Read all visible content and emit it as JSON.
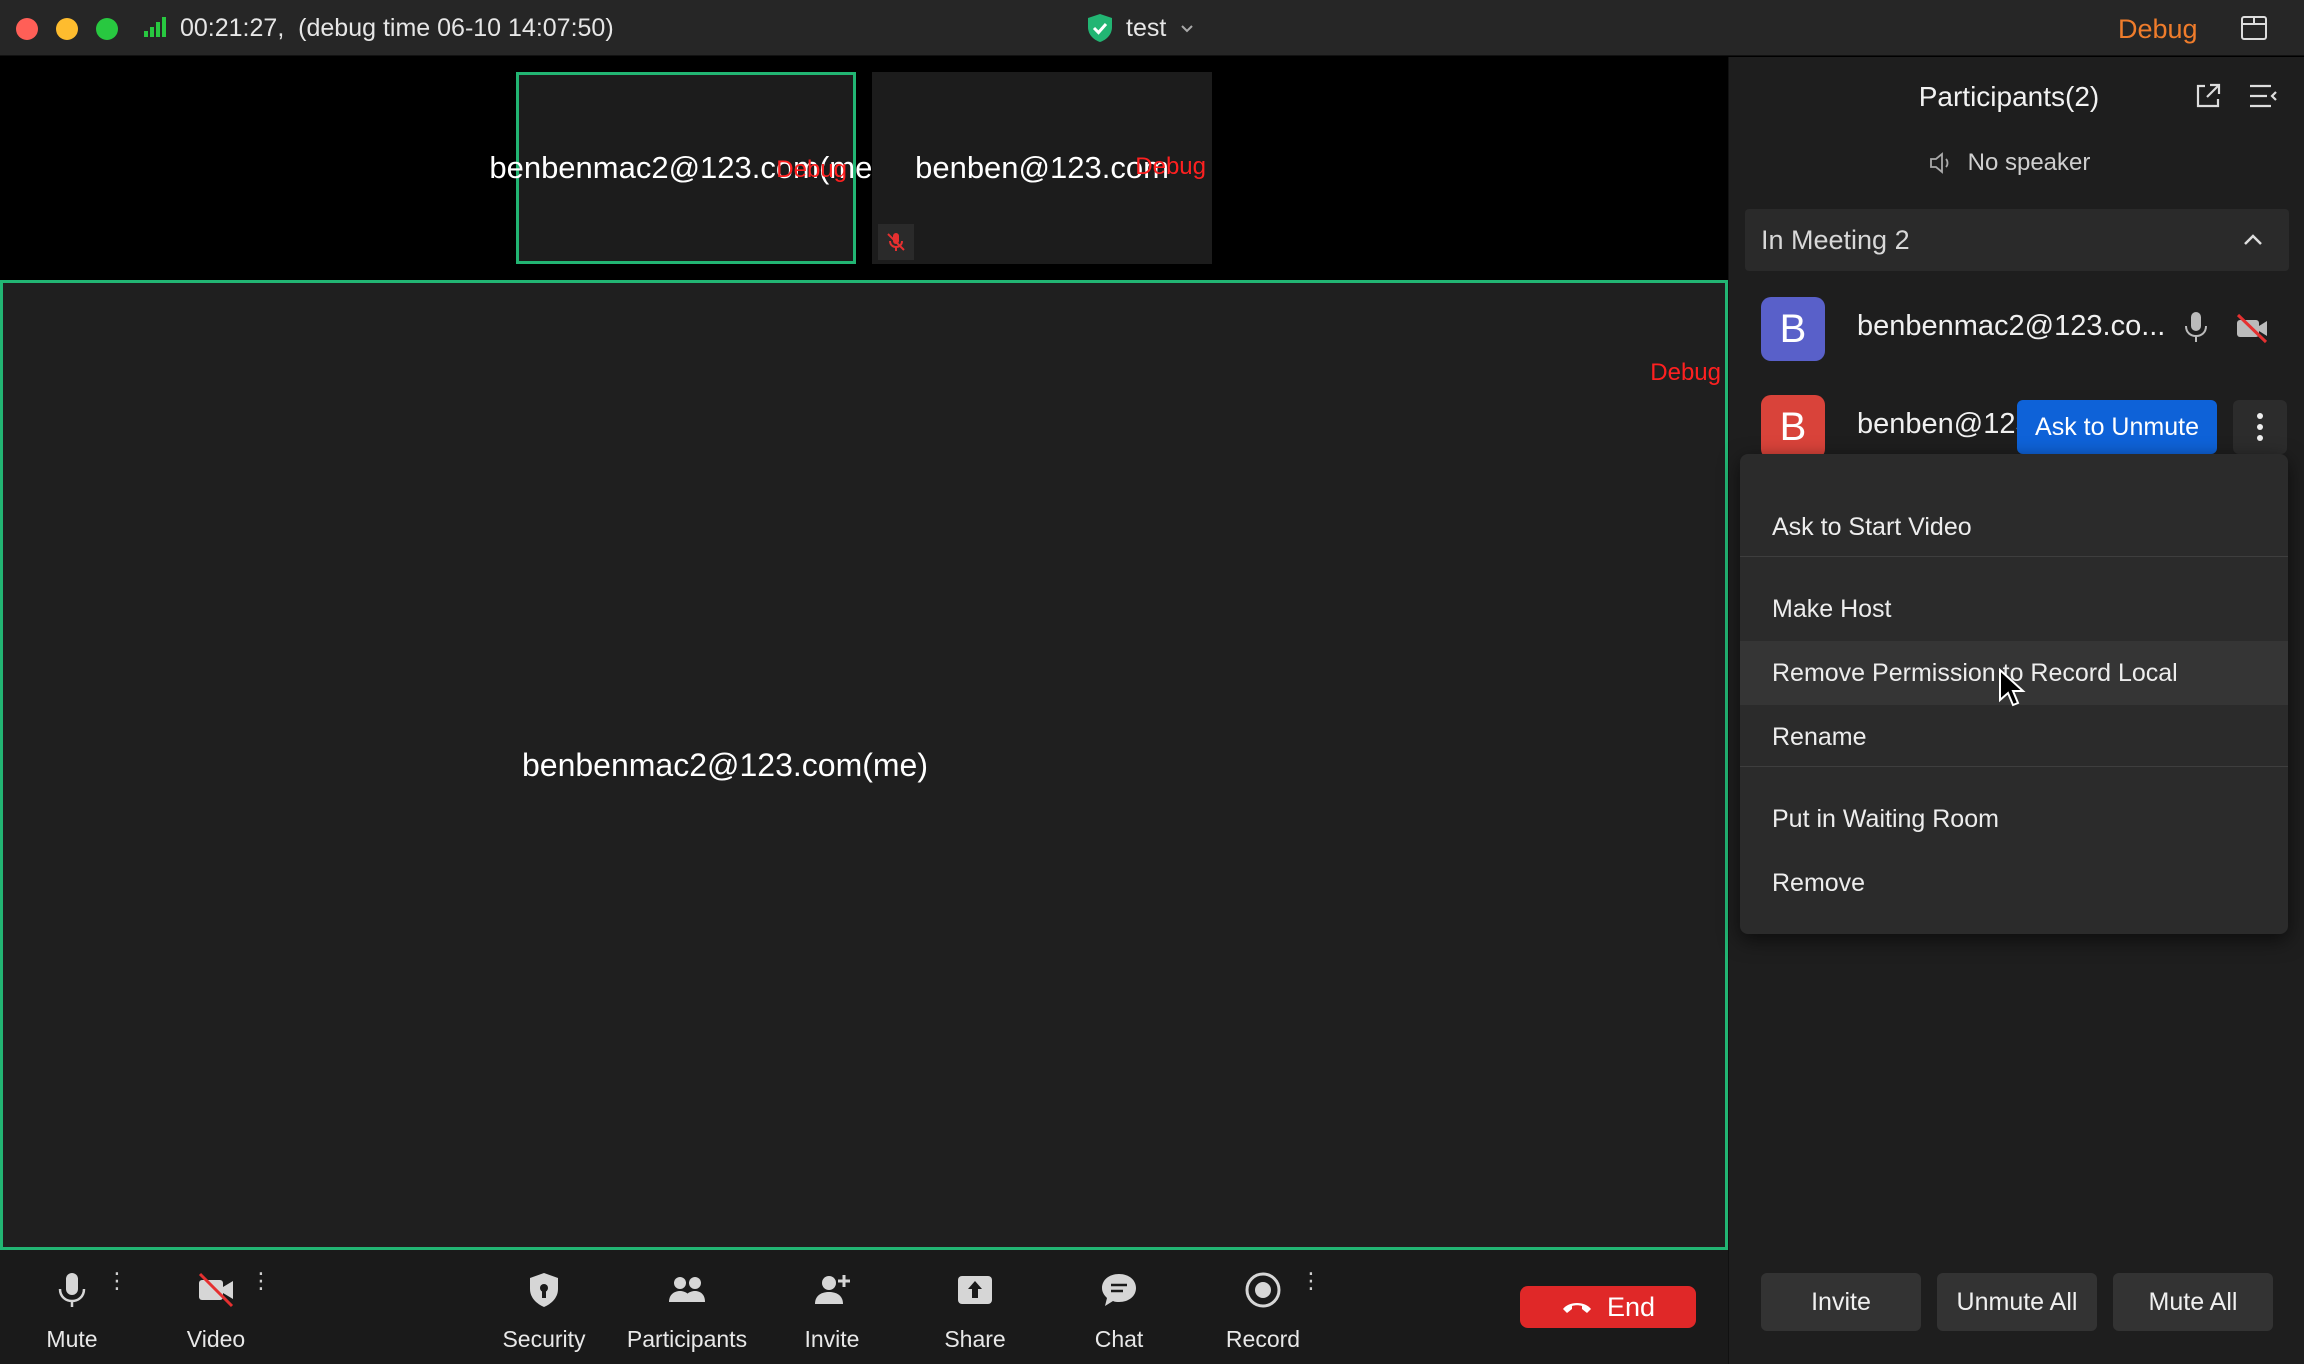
{
  "titlebar": {
    "timer": "00:21:27,",
    "debug_time": "(debug time 06-10 14:07:50)",
    "meeting_name": "test",
    "debug_label": "Debug"
  },
  "thumbnails": [
    {
      "name": "benbenmac2@123.com(me)",
      "debug": "Debug",
      "active": true
    },
    {
      "name": "benben@123.com",
      "debug": "Debug",
      "muted": true
    }
  ],
  "main_video": {
    "name": "benbenmac2@123.com(me)",
    "debug": "Debug"
  },
  "toolbar": {
    "mute": "Mute",
    "video": "Video",
    "security": "Security",
    "participants": "Participants",
    "invite": "Invite",
    "share": "Share",
    "chat": "Chat",
    "record": "Record",
    "end": "End",
    "more_glyph": "⋮"
  },
  "panel": {
    "title": "Participants(2)",
    "speaker": "No speaker",
    "section": "In Meeting 2",
    "participants": [
      {
        "initial": "B",
        "name": "benbenmac2@123.co...",
        "color": "#5960c9"
      },
      {
        "initial": "B",
        "name": "benben@123",
        "color": "#d9433a",
        "action": "Ask to Unmute"
      }
    ],
    "menu": [
      "Ask to Start Video",
      "Make Host",
      "Remove Permission to Record Local",
      "Rename",
      "Put in Waiting Room",
      "Remove"
    ],
    "footer": {
      "invite": "Invite",
      "unmute_all": "Unmute All",
      "mute_all": "Mute All"
    }
  },
  "colors": {
    "accent_green": "#22b573",
    "end_red": "#e02828",
    "ask_blue": "#0e62d8",
    "debug_orange": "#ef7c2b",
    "debug_red": "#ff2020"
  }
}
